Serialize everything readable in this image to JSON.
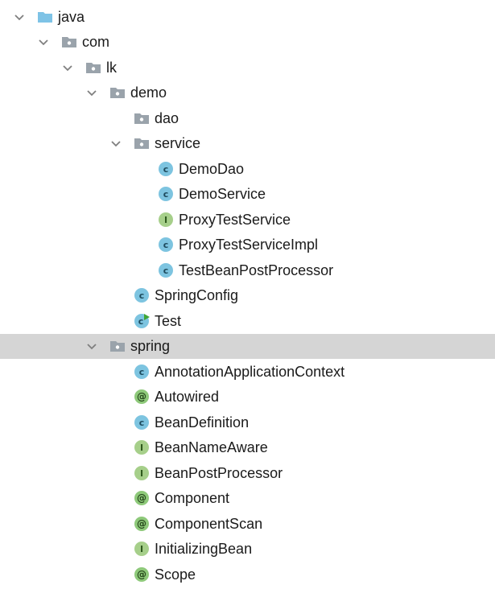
{
  "tree": {
    "java": "java",
    "com": "com",
    "lk": "lk",
    "demo": "demo",
    "dao": "dao",
    "service": "service",
    "service_items": [
      "DemoDao",
      "DemoService",
      "ProxyTestService",
      "ProxyTestServiceImpl",
      "TestBeanPostProcessor"
    ],
    "springconfig": "SpringConfig",
    "test": "Test",
    "spring": "spring",
    "spring_items": [
      "AnnotationApplicationContext",
      "Autowired",
      "BeanDefinition",
      "BeanNameAware",
      "BeanPostProcessor",
      "Component",
      "ComponentScan",
      "InitializingBean",
      "Scope"
    ]
  },
  "colors": {
    "class_icon": "#7dc4e0",
    "interface_icon": "#a6cf8a",
    "annotation_icon": "#8ec97a",
    "folder": "#9aa3ab",
    "source_folder": "#7ec3e6",
    "selection": "#d5d5d5"
  },
  "icons": {
    "expanded": "chevron-down-icon",
    "source_root": "source-folder-icon",
    "package": "package-folder-icon",
    "class": "class-c-icon",
    "interface": "interface-i-icon",
    "annotation": "annotation-at-icon",
    "runnable_class": "runnable-class-icon"
  }
}
